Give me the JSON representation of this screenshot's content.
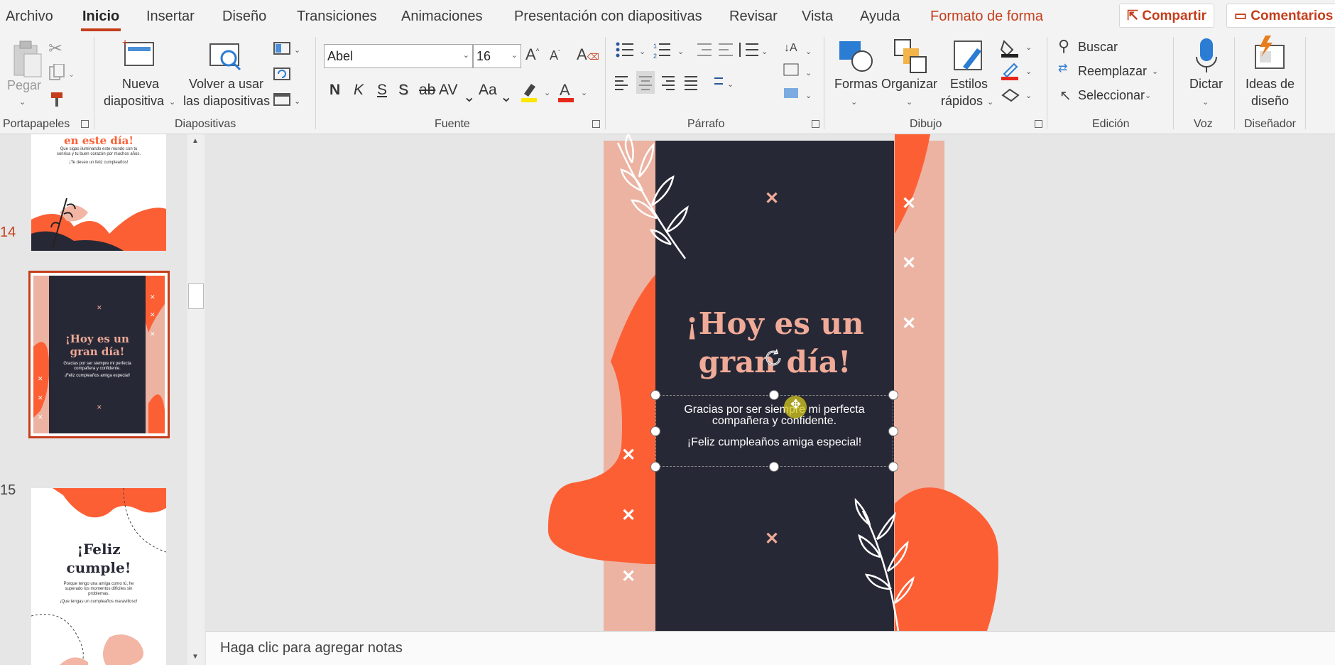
{
  "tabs": {
    "items": [
      "Archivo",
      "Inicio",
      "Insertar",
      "Diseño",
      "Transiciones",
      "Animaciones",
      "Presentación con diapositivas",
      "Revisar",
      "Vista",
      "Ayuda"
    ],
    "format_tab": "Formato de forma",
    "share": "Compartir",
    "comments": "Comentarios"
  },
  "ribbon": {
    "clipboard": {
      "paste": "Pegar",
      "group": "Portapapeles"
    },
    "slides": {
      "new_slide_l1": "Nueva",
      "new_slide_l2": "diapositiva",
      "reuse_l1": "Volver a usar",
      "reuse_l2": "las diapositivas",
      "group": "Diapositivas"
    },
    "font": {
      "font_name": "Abel",
      "font_size": "16",
      "bold": "N",
      "italic": "K",
      "underline": "S",
      "shadow": "S",
      "strike": "ab",
      "spacing": "AV",
      "case": "Aa",
      "group": "Fuente"
    },
    "paragraph": {
      "group": "Párrafo"
    },
    "drawing": {
      "shapes": "Formas",
      "arrange": "Organizar",
      "styles_l1": "Estilos",
      "styles_l2": "rápidos",
      "group": "Dibujo"
    },
    "editing": {
      "find": "Buscar",
      "replace": "Reemplazar",
      "select": "Seleccionar",
      "group": "Edición"
    },
    "voice": {
      "dictate": "Dictar",
      "group": "Voz"
    },
    "designer": {
      "ideas_l1": "Ideas de",
      "ideas_l2": "diseño",
      "group": "Diseñador"
    }
  },
  "thumbnails": {
    "prev": {
      "title": "en este día!",
      "line1": "Que sigas iluminando este mundo con tu",
      "line2": "sonrisa y tu buen corazón por muchos años.",
      "line3": "¡Te deseo un feliz cumpleaños!"
    },
    "current": {
      "number": "14",
      "title_l1": "¡Hoy es un",
      "title_l2": "gran día!",
      "line1": "Gracias por ser siempre mi perfecta",
      "line2": "compañera y confidente.",
      "line3": "¡Feliz cumpleaños amiga especial!"
    },
    "next": {
      "number": "15",
      "title_l1": "¡Feliz",
      "title_l2": "cumple!",
      "line1": "Porque tengo una amiga como tú, he",
      "line2": "superado los momentos difíciles sin",
      "line3": "problemas.",
      "line4": "¡Que tengas un cumpleaños maravilloso!"
    }
  },
  "slide": {
    "title_l1": "¡Hoy es un",
    "title_l2": "gran día!",
    "body_l1": "Gracias por ser siempre mi perfecta",
    "body_l2": "compañera y confidente.",
    "body_l3": "¡Feliz cumpleaños amiga especial!"
  },
  "notes": {
    "placeholder": "Haga clic para agregar notas"
  },
  "colors": {
    "accent": "#c43e1c",
    "orange": "#fd5f35",
    "dark": "#272835",
    "pink": "#ecb3a2",
    "title_pink": "#f0aa98"
  }
}
